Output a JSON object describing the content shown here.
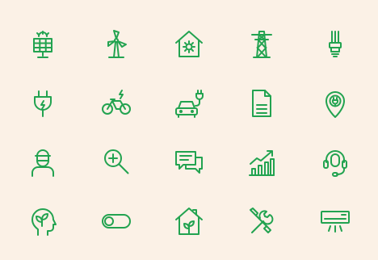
{
  "colors": {
    "background": "#fbf1e6",
    "icon_stroke": "#22a350"
  },
  "icons": [
    "solar-panel-icon",
    "wind-turbine-icon",
    "solar-house-icon",
    "power-pylon-icon",
    "led-bulb-icon",
    "power-plug-icon",
    "electric-bicycle-icon",
    "electric-car-charging-icon",
    "document-icon",
    "charging-location-pin-icon",
    "worker-person-icon",
    "zoom-in-magnifier-icon",
    "chat-bubbles-icon",
    "growth-bar-chart-icon",
    "headset-support-icon",
    "eco-head-icon",
    "toggle-switch-icon",
    "eco-house-icon",
    "wrench-screwdriver-icon",
    "air-conditioner-icon"
  ]
}
